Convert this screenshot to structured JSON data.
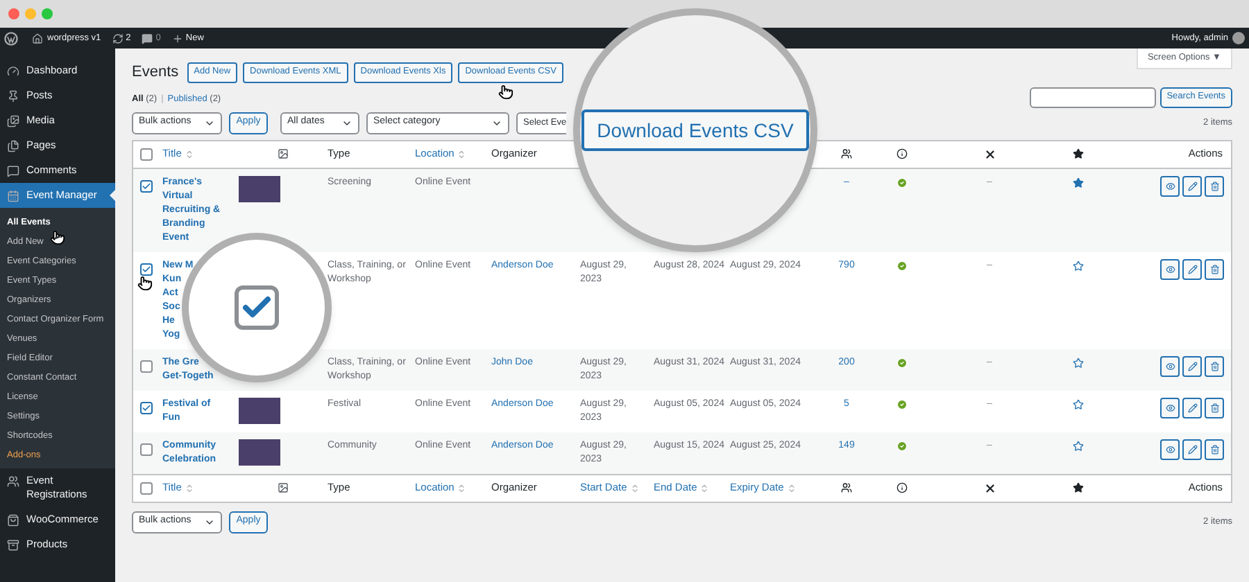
{
  "admin_bar": {
    "site": "wordpress v1",
    "updates": "2",
    "comments": "0",
    "new": "New",
    "greeting": "Howdy, admin"
  },
  "sidebar": {
    "items": [
      {
        "label": "Dashboard",
        "selected": false
      },
      {
        "label": "Posts",
        "selected": false
      },
      {
        "label": "Media",
        "selected": false
      },
      {
        "label": "Pages",
        "selected": false
      },
      {
        "label": "Comments",
        "selected": false
      },
      {
        "label": "Event Manager",
        "selected": true,
        "children": [
          {
            "label": "All Events",
            "selected": true,
            "kind": "sub"
          },
          {
            "label": "Add New",
            "selected": false,
            "kind": "sub"
          },
          {
            "label": "Event Categories",
            "selected": false,
            "kind": "sub"
          },
          {
            "label": "Event Types",
            "selected": false,
            "kind": "sub"
          },
          {
            "label": "Organizers",
            "selected": false,
            "kind": "sub"
          },
          {
            "label": "Contact Organizer Form",
            "selected": false,
            "kind": "sub"
          },
          {
            "label": "Venues",
            "selected": false,
            "kind": "sub"
          },
          {
            "label": "Field Editor",
            "selected": false,
            "kind": "sub"
          },
          {
            "label": "Constant Contact",
            "selected": false,
            "kind": "sub"
          },
          {
            "label": "License",
            "selected": false,
            "kind": "sub"
          },
          {
            "label": "Settings",
            "selected": false,
            "kind": "sub"
          },
          {
            "label": "Shortcodes",
            "selected": false,
            "kind": "sub"
          },
          {
            "label": "Add-ons",
            "selected": false,
            "kind": "addon"
          }
        ]
      },
      {
        "label": "Event Registrations",
        "selected": false
      },
      {
        "label": "WooCommerce",
        "selected": false
      },
      {
        "label": "Products",
        "selected": false
      }
    ]
  },
  "screen_options": "Screen Options ▼",
  "page_title": "Events",
  "title_buttons": [
    "Add New",
    "Download Events XML",
    "Download Events Xls",
    "Download Events CSV"
  ],
  "views": [
    {
      "label": "All",
      "count": "(2)",
      "selected": true
    },
    {
      "label": "Published",
      "count": "(2)",
      "selected": false
    }
  ],
  "search": {
    "button": "Search Events"
  },
  "filters": {
    "bulk_actions": "Bulk actions",
    "apply": "Apply",
    "dates": "All dates",
    "category": "Select category",
    "event_type": "Select Eve"
  },
  "item_count_top": "2 items",
  "view_separator": "|",
  "header": {
    "checked": false,
    "title": {
      "label": "Title",
      "sortable": true
    },
    "type": {
      "label": "Type",
      "sortable": false
    },
    "location": {
      "label": "Location",
      "sortable": true
    },
    "organizer": {
      "label": "Organizer",
      "sortable": false
    },
    "actions": {
      "label": "Actions",
      "sortable": false
    }
  },
  "rows": [
    {
      "checked": true,
      "title_lines": [
        "France's",
        "Virtual",
        "Recruiting &",
        "Branding",
        "Event"
      ],
      "has_photo": true,
      "type": "Screening",
      "location": "Online Event",
      "count": "–",
      "published": true,
      "x_value": "–",
      "featured": true
    },
    {
      "checked": true,
      "title_lines": [
        "New M",
        "Kun",
        "Act",
        "Soc",
        "He",
        "Yog"
      ],
      "has_photo": false,
      "type": "Class, Training, or Workshop",
      "location": "Online Event",
      "organizer": "Anderson Doe",
      "start": "August 29, 2023",
      "end": "August 28, 2024",
      "expiry": "August 29, 2024",
      "count": "790",
      "published": true,
      "x_value": "–",
      "featured": false
    },
    {
      "checked": false,
      "title_lines": [
        "The Gre",
        "Get-Togeth"
      ],
      "has_photo": false,
      "type": "Class, Training, or Workshop",
      "location": "Online Event",
      "organizer": "John Doe",
      "start": "August 29, 2023",
      "end": "August 31, 2024",
      "expiry": "August 31, 2024",
      "count": "200",
      "published": true,
      "x_value": "–",
      "featured": false
    },
    {
      "checked": true,
      "title_lines": [
        "Festival of",
        "Fun"
      ],
      "has_photo": true,
      "type": "Festival",
      "location": "Online Event",
      "organizer": "Anderson Doe",
      "start": "August 29, 2023",
      "end": "August 05, 2024",
      "expiry": "August 05, 2024",
      "count": "5",
      "published": true,
      "x_value": "–",
      "featured": false
    },
    {
      "checked": false,
      "title_lines": [
        "Community",
        "Celebration"
      ],
      "has_photo": true,
      "type": "Community",
      "location": "Online Event",
      "organizer": "Anderson Doe",
      "start": "August 29, 2023",
      "end": "August 15, 2024",
      "expiry": "August 25, 2024",
      "count": "149",
      "published": true,
      "x_value": "–",
      "featured": false
    }
  ],
  "footer": {
    "checked": false,
    "title": {
      "label": "Title",
      "sortable": true
    },
    "type": {
      "label": "Type",
      "sortable": false
    },
    "location": {
      "label": "Location",
      "sortable": true
    },
    "organizer": {
      "label": "Organizer",
      "sortable": false
    },
    "start_date": {
      "label": "Start Date",
      "sortable": true
    },
    "end_date": {
      "label": "End Date",
      "sortable": true
    },
    "expiry_date": {
      "label": "Expiry Date",
      "sortable": true
    },
    "actions": {
      "label": "Actions",
      "sortable": false
    }
  },
  "bottom_filters": {
    "bulk_actions": "Bulk actions",
    "apply": "Apply"
  },
  "item_count_bottom": "2 items",
  "magnifier_top": {
    "button": "Download Events CSV"
  },
  "magnifier_bottom": {
    "checked": true
  }
}
